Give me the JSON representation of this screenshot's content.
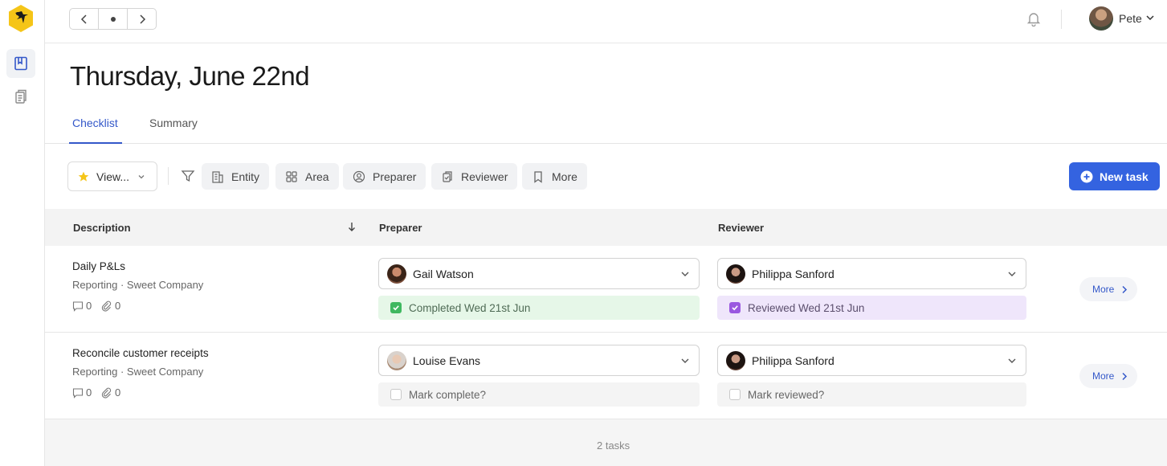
{
  "header": {
    "user_name": "Pete"
  },
  "page": {
    "title": "Thursday, June 22nd",
    "tabs": [
      {
        "label": "Checklist",
        "active": true
      },
      {
        "label": "Summary",
        "active": false
      }
    ]
  },
  "toolbar": {
    "view_label": "View...",
    "filters": [
      "Entity",
      "Area",
      "Preparer",
      "Reviewer",
      "More"
    ],
    "new_task_label": "New task",
    "accent": "#3463e0"
  },
  "table": {
    "columns": {
      "description": "Description",
      "preparer": "Preparer",
      "reviewer": "Reviewer"
    },
    "rows": [
      {
        "title": "Daily P&Ls",
        "subtitle": "Reporting · Sweet Company",
        "comments": "0",
        "attachments": "0",
        "preparer": "Gail Watson",
        "preparer_status": "Completed Wed 21st Jun",
        "reviewer": "Philippa Sanford",
        "reviewer_status": "Reviewed Wed 21st Jun",
        "more_label": "More"
      },
      {
        "title": "Reconcile customer receipts",
        "subtitle": "Reporting · Sweet Company",
        "comments": "0",
        "attachments": "0",
        "preparer": "Louise Evans",
        "preparer_status": "Mark complete?",
        "reviewer": "Philippa Sanford",
        "reviewer_status": "Mark reviewed?",
        "more_label": "More"
      }
    ]
  },
  "footer": {
    "count_label": "2 tasks"
  }
}
